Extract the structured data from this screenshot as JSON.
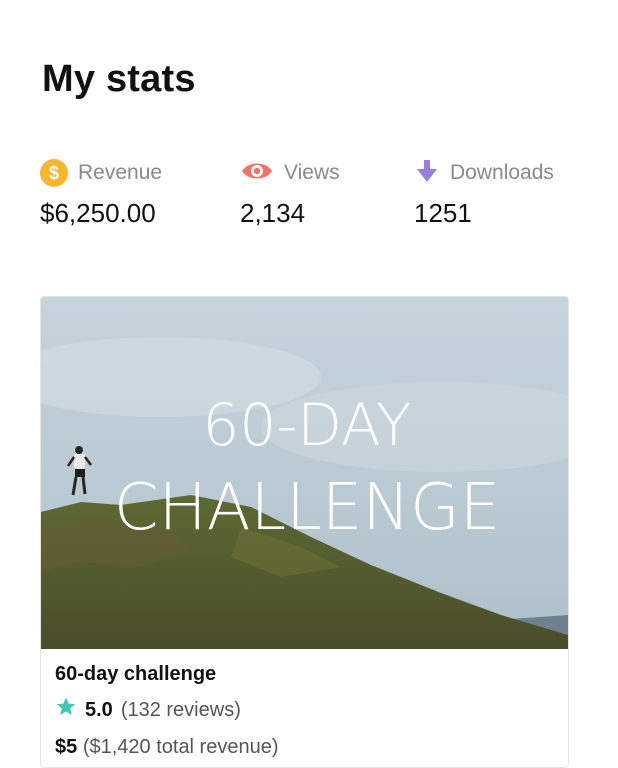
{
  "page": {
    "title": "My stats"
  },
  "stats": [
    {
      "label": "Revenue",
      "value": "$6,250.00",
      "icon": "dollar-coin-icon",
      "icon_color": "#f5b731"
    },
    {
      "label": "Views",
      "value": "2,134",
      "icon": "eye-icon",
      "icon_color": "#f0736a"
    },
    {
      "label": "Downloads",
      "value": "1251",
      "icon": "download-arrow-icon",
      "icon_color": "#9b7fe0"
    }
  ],
  "product": {
    "image_text_line1": "60-DAY",
    "image_text_line2": "CHALLENGE",
    "title": "60-day challenge",
    "rating": "5.0",
    "reviews": "(132 reviews)",
    "price": "$5",
    "revenue_note": "($1,420 total revenue)",
    "star_color": "#3ec9b0"
  }
}
